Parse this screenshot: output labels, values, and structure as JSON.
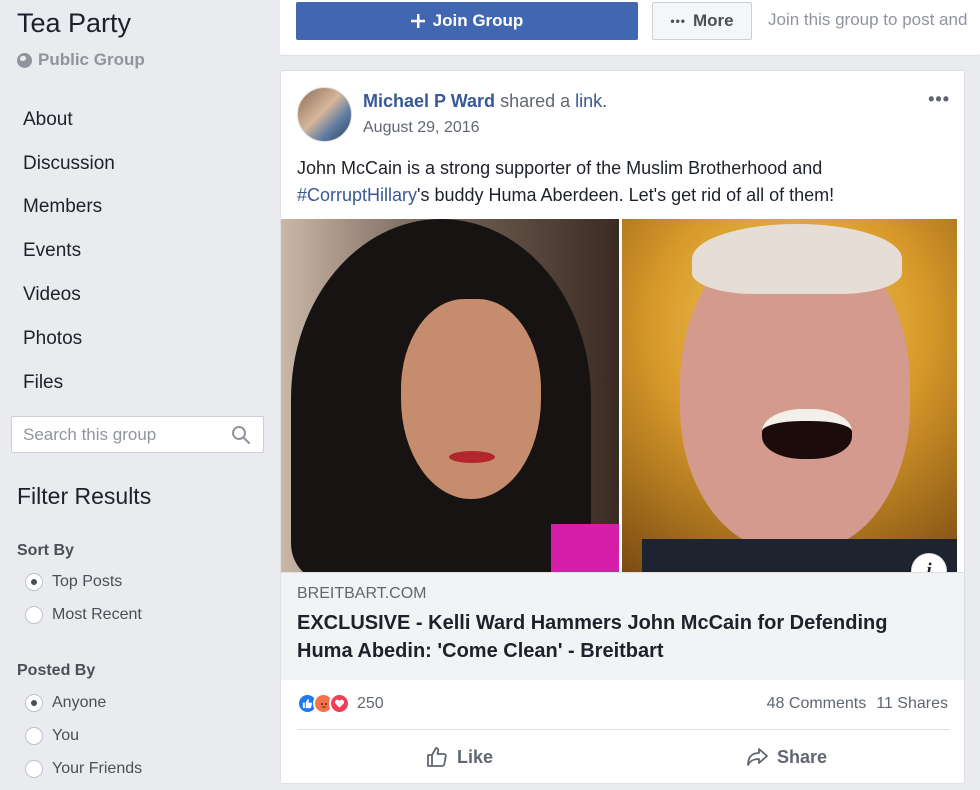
{
  "group": {
    "title": "Tea Party",
    "type": "Public Group"
  },
  "sidebar": {
    "items": [
      {
        "label": "About"
      },
      {
        "label": "Discussion"
      },
      {
        "label": "Members"
      },
      {
        "label": "Events"
      },
      {
        "label": "Videos"
      },
      {
        "label": "Photos"
      },
      {
        "label": "Files"
      }
    ],
    "search_placeholder": "Search this group",
    "filter_title": "Filter Results",
    "sort_by": {
      "label": "Sort By",
      "options": [
        {
          "label": "Top Posts",
          "selected": true
        },
        {
          "label": "Most Recent",
          "selected": false
        }
      ]
    },
    "posted_by": {
      "label": "Posted By",
      "options": [
        {
          "label": "Anyone",
          "selected": true
        },
        {
          "label": "You",
          "selected": false
        },
        {
          "label": "Your Friends",
          "selected": false
        }
      ]
    }
  },
  "topbar": {
    "join_label": "Join Group",
    "more_label": "More",
    "join_note": "Join this group to post and"
  },
  "post": {
    "author": "Michael P Ward",
    "action_text": "shared a",
    "action_link": "link.",
    "date": "August 29, 2016",
    "text_part1": "John McCain is a strong supporter of the Muslim Brotherhood and",
    "hashtag": "#CorruptHillary",
    "text_part2": "'s buddy Huma Aberdeen. Let's get rid of all of them!",
    "link": {
      "domain": "BREITBART.COM",
      "title": "EXCLUSIVE - Kelli Ward Hammers John McCain for Defending Huma Abedin: 'Come Clean' - Breitbart"
    },
    "reaction_count": "250",
    "comments": "48 Comments",
    "shares": "11 Shares",
    "like_label": "Like",
    "share_label": "Share"
  },
  "colors": {
    "brand_blue": "#4267b2",
    "link_blue": "#385898",
    "background": "#e9ebee"
  }
}
